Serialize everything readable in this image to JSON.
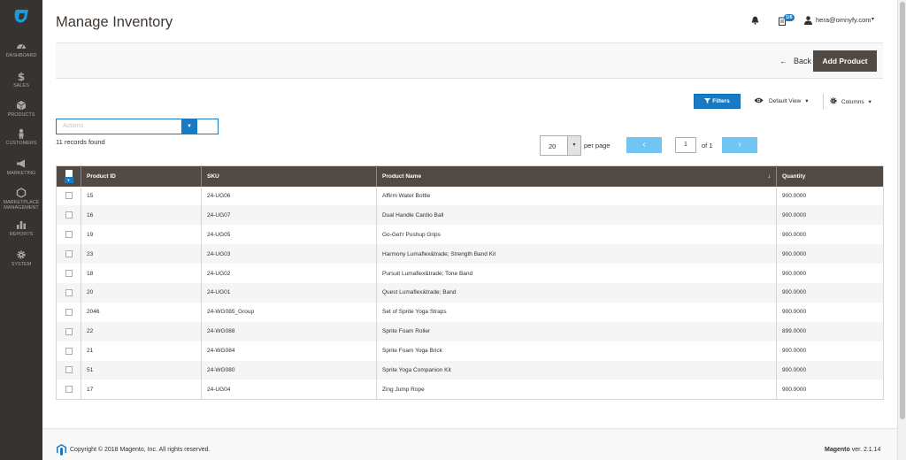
{
  "nav": [
    {
      "label": "DASHBOARD",
      "icon": "dashboard-icon"
    },
    {
      "label": "SALES",
      "icon": "dollar-icon"
    },
    {
      "label": "PRODUCTS",
      "icon": "cube-icon"
    },
    {
      "label": "CUSTOMERS",
      "icon": "person-icon"
    },
    {
      "label": "MARKETING",
      "icon": "megaphone-icon"
    },
    {
      "label1": "MARKETPLACE",
      "label2": "MANAGEMENT",
      "icon": "hexagon-icon"
    },
    {
      "label": "REPORTS",
      "icon": "bar-chart-icon"
    },
    {
      "label": "SYSTEM",
      "icon": "gear-icon"
    }
  ],
  "header": {
    "title": "Manage Inventory",
    "notif_count": "1/6",
    "user": "hera@omnyfy.com"
  },
  "pagebar": {
    "back": "Back",
    "add": "Add Product"
  },
  "toolbar": {
    "filters": "Filters",
    "view": "Default View",
    "columns": "Columns"
  },
  "actions": {
    "placeholder": "Actions",
    "records": "11 records found"
  },
  "pager": {
    "per_page_value": "20",
    "per_page_label": "per page",
    "page": "1",
    "of": "of 1"
  },
  "table": {
    "headers": [
      "Product ID",
      "SKU",
      "Product Name",
      "Quantity"
    ],
    "rows": [
      [
        "15",
        "24-UG06",
        "Affirm Water Bottle",
        "900.0000"
      ],
      [
        "16",
        "24-UG07",
        "Dual Handle Cardio Ball",
        "900.0000"
      ],
      [
        "19",
        "24-UG05",
        "Go-Get'r Pushup Grips",
        "900.0000"
      ],
      [
        "23",
        "24-UG03",
        "Harmony Lumaflex&trade; Strength Band Kit",
        "900.0000"
      ],
      [
        "18",
        "24-UG02",
        "Pursuit Lumaflex&trade; Tone Band",
        "900.0000"
      ],
      [
        "20",
        "24-UG01",
        "Quest Lumaflex&trade; Band",
        "900.0000"
      ],
      [
        "2046",
        "24-WG085_Group",
        "Set of Sprite Yoga Straps",
        "900.0000"
      ],
      [
        "22",
        "24-WG088",
        "Sprite Foam Roller",
        "899.0000"
      ],
      [
        "21",
        "24-WG084",
        "Sprite Foam Yoga Brick",
        "900.0000"
      ],
      [
        "51",
        "24-WG080",
        "Sprite Yoga Companion Kit",
        "900.0000"
      ],
      [
        "17",
        "24-UG04",
        "Zing Jump Rope",
        "900.0000"
      ]
    ]
  },
  "footer": {
    "copyright": "Copyright © 2018 Magento, Inc. All rights reserved.",
    "brand": "Magento",
    "version": " ver. 2.1.14"
  },
  "colors": {
    "sidebar": "#373330",
    "accent": "#1979c3",
    "header_row": "#514943",
    "pager": "#70c5f2"
  }
}
